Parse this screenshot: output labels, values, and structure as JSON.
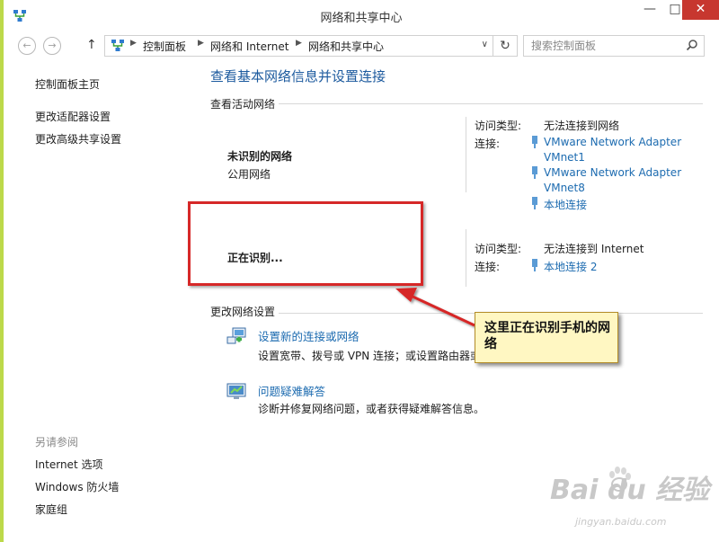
{
  "window": {
    "title": "网络和共享中心",
    "minimize_label": "—",
    "maximize_label": "□",
    "close_label": "✕"
  },
  "nav": {
    "back_icon": "←",
    "forward_icon": "→",
    "up_icon": "↑",
    "breadcrumb": [
      "控制面板",
      "网络和 Internet",
      "网络和共享中心"
    ],
    "separator": "▶",
    "dropdown_icon": "∨",
    "refresh_icon": "↻",
    "search_placeholder": "搜索控制面板"
  },
  "sidebar": {
    "items": [
      {
        "label": "控制面板主页"
      },
      {
        "label": "更改适配器设置"
      },
      {
        "label": "更改高级共享设置"
      }
    ],
    "see_also_label": "另请参阅",
    "see_also_items": [
      {
        "label": "Internet 选项"
      },
      {
        "label": "Windows 防火墙"
      },
      {
        "label": "家庭组"
      }
    ]
  },
  "main": {
    "heading": "查看基本网络信息并设置连接",
    "active_networks_label": "查看活动网络",
    "networks": [
      {
        "name": "未识别的网络",
        "type": "公用网络",
        "access_label": "访问类型:",
        "access_value": "无法连接到网络",
        "conn_label": "连接:",
        "connections": [
          "VMware Network Adapter",
          "VMnet1",
          "VMware Network Adapter",
          "VMnet8",
          "本地连接"
        ]
      },
      {
        "name": "正在识别...",
        "access_label": "访问类型:",
        "access_value": "无法连接到 Internet",
        "conn_label": "连接:",
        "connections": [
          "本地连接 2"
        ]
      }
    ],
    "change_settings_label": "更改网络设置",
    "tasks": [
      {
        "title": "设置新的连接或网络",
        "desc": "设置宽带、拨号或 VPN 连接；或设置路由器或"
      },
      {
        "title": "问题疑难解答",
        "desc": "诊断并修复网络问题，或者获得疑难解答信息。"
      }
    ]
  },
  "annotation": {
    "callout_text": "这里正在识别手机的网络",
    "accent": "#d62828"
  },
  "watermark": {
    "brand": "Bai  du 经验",
    "url": "jingyan.baidu.com"
  },
  "colors": {
    "link": "#1c6bb0",
    "heading": "#1c5a9e",
    "close_button": "#c7372f"
  }
}
